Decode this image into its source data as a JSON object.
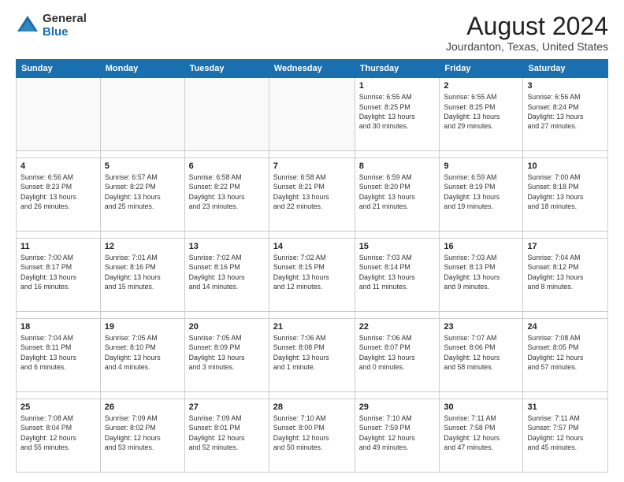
{
  "logo": {
    "general": "General",
    "blue": "Blue"
  },
  "header": {
    "title": "August 2024",
    "subtitle": "Jourdanton, Texas, United States"
  },
  "weekdays": [
    "Sunday",
    "Monday",
    "Tuesday",
    "Wednesday",
    "Thursday",
    "Friday",
    "Saturday"
  ],
  "weeks": [
    [
      {
        "num": "",
        "info": ""
      },
      {
        "num": "",
        "info": ""
      },
      {
        "num": "",
        "info": ""
      },
      {
        "num": "",
        "info": ""
      },
      {
        "num": "1",
        "info": "Sunrise: 6:55 AM\nSunset: 8:25 PM\nDaylight: 13 hours\nand 30 minutes."
      },
      {
        "num": "2",
        "info": "Sunrise: 6:55 AM\nSunset: 8:25 PM\nDaylight: 13 hours\nand 29 minutes."
      },
      {
        "num": "3",
        "info": "Sunrise: 6:56 AM\nSunset: 8:24 PM\nDaylight: 13 hours\nand 27 minutes."
      }
    ],
    [
      {
        "num": "4",
        "info": "Sunrise: 6:56 AM\nSunset: 8:23 PM\nDaylight: 13 hours\nand 26 minutes."
      },
      {
        "num": "5",
        "info": "Sunrise: 6:57 AM\nSunset: 8:22 PM\nDaylight: 13 hours\nand 25 minutes."
      },
      {
        "num": "6",
        "info": "Sunrise: 6:58 AM\nSunset: 8:22 PM\nDaylight: 13 hours\nand 23 minutes."
      },
      {
        "num": "7",
        "info": "Sunrise: 6:58 AM\nSunset: 8:21 PM\nDaylight: 13 hours\nand 22 minutes."
      },
      {
        "num": "8",
        "info": "Sunrise: 6:59 AM\nSunset: 8:20 PM\nDaylight: 13 hours\nand 21 minutes."
      },
      {
        "num": "9",
        "info": "Sunrise: 6:59 AM\nSunset: 8:19 PM\nDaylight: 13 hours\nand 19 minutes."
      },
      {
        "num": "10",
        "info": "Sunrise: 7:00 AM\nSunset: 8:18 PM\nDaylight: 13 hours\nand 18 minutes."
      }
    ],
    [
      {
        "num": "11",
        "info": "Sunrise: 7:00 AM\nSunset: 8:17 PM\nDaylight: 13 hours\nand 16 minutes."
      },
      {
        "num": "12",
        "info": "Sunrise: 7:01 AM\nSunset: 8:16 PM\nDaylight: 13 hours\nand 15 minutes."
      },
      {
        "num": "13",
        "info": "Sunrise: 7:02 AM\nSunset: 8:16 PM\nDaylight: 13 hours\nand 14 minutes."
      },
      {
        "num": "14",
        "info": "Sunrise: 7:02 AM\nSunset: 8:15 PM\nDaylight: 13 hours\nand 12 minutes."
      },
      {
        "num": "15",
        "info": "Sunrise: 7:03 AM\nSunset: 8:14 PM\nDaylight: 13 hours\nand 11 minutes."
      },
      {
        "num": "16",
        "info": "Sunrise: 7:03 AM\nSunset: 8:13 PM\nDaylight: 13 hours\nand 9 minutes."
      },
      {
        "num": "17",
        "info": "Sunrise: 7:04 AM\nSunset: 8:12 PM\nDaylight: 13 hours\nand 8 minutes."
      }
    ],
    [
      {
        "num": "18",
        "info": "Sunrise: 7:04 AM\nSunset: 8:11 PM\nDaylight: 13 hours\nand 6 minutes."
      },
      {
        "num": "19",
        "info": "Sunrise: 7:05 AM\nSunset: 8:10 PM\nDaylight: 13 hours\nand 4 minutes."
      },
      {
        "num": "20",
        "info": "Sunrise: 7:05 AM\nSunset: 8:09 PM\nDaylight: 13 hours\nand 3 minutes."
      },
      {
        "num": "21",
        "info": "Sunrise: 7:06 AM\nSunset: 8:08 PM\nDaylight: 13 hours\nand 1 minute."
      },
      {
        "num": "22",
        "info": "Sunrise: 7:06 AM\nSunset: 8:07 PM\nDaylight: 13 hours\nand 0 minutes."
      },
      {
        "num": "23",
        "info": "Sunrise: 7:07 AM\nSunset: 8:06 PM\nDaylight: 12 hours\nand 58 minutes."
      },
      {
        "num": "24",
        "info": "Sunrise: 7:08 AM\nSunset: 8:05 PM\nDaylight: 12 hours\nand 57 minutes."
      }
    ],
    [
      {
        "num": "25",
        "info": "Sunrise: 7:08 AM\nSunset: 8:04 PM\nDaylight: 12 hours\nand 55 minutes."
      },
      {
        "num": "26",
        "info": "Sunrise: 7:09 AM\nSunset: 8:02 PM\nDaylight: 12 hours\nand 53 minutes."
      },
      {
        "num": "27",
        "info": "Sunrise: 7:09 AM\nSunset: 8:01 PM\nDaylight: 12 hours\nand 52 minutes."
      },
      {
        "num": "28",
        "info": "Sunrise: 7:10 AM\nSunset: 8:00 PM\nDaylight: 12 hours\nand 50 minutes."
      },
      {
        "num": "29",
        "info": "Sunrise: 7:10 AM\nSunset: 7:59 PM\nDaylight: 12 hours\nand 49 minutes."
      },
      {
        "num": "30",
        "info": "Sunrise: 7:11 AM\nSunset: 7:58 PM\nDaylight: 12 hours\nand 47 minutes."
      },
      {
        "num": "31",
        "info": "Sunrise: 7:11 AM\nSunset: 7:57 PM\nDaylight: 12 hours\nand 45 minutes."
      }
    ]
  ]
}
